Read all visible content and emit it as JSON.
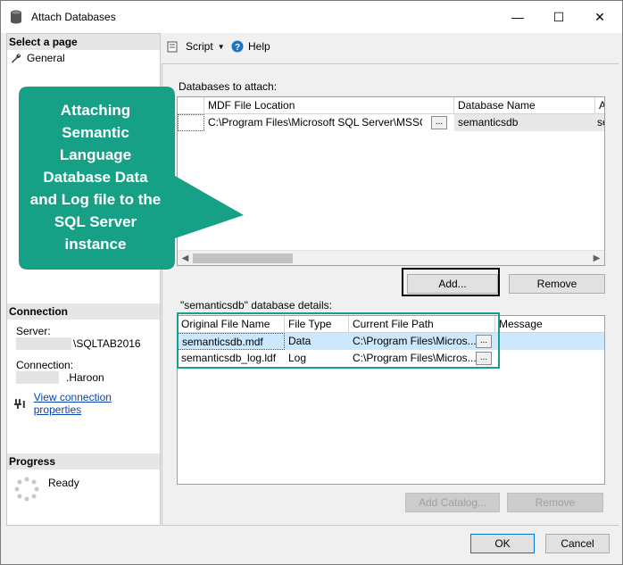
{
  "window": {
    "title": "Attach Databases",
    "minimize": "—",
    "maximize": "☐",
    "close": "✕"
  },
  "left": {
    "select_page_header": "Select a page",
    "pages": [
      {
        "label": "General",
        "icon": "wrench-icon"
      }
    ],
    "connection_header": "Connection",
    "server_label": "Server:",
    "server_value": "\\SQLTAB2016",
    "connection_label": "Connection:",
    "connection_value": ".Haroon",
    "view_connection_link": "View connection properties",
    "progress_header": "Progress",
    "progress_status": "Ready"
  },
  "toolbar": {
    "script_label": "Script",
    "help_label": "Help"
  },
  "attach": {
    "label": "Databases to attach:",
    "columns": [
      "MDF File Location",
      "Database Name",
      "At"
    ],
    "rows": [
      {
        "mdf": "C:\\Program Files\\Microsoft SQL Server\\MSSQL...",
        "browse": "...",
        "db_name": "semanticsdb",
        "attach_as": "se"
      }
    ],
    "add_button": "Add...",
    "remove_button": "Remove"
  },
  "details": {
    "label": "\"semanticsdb\" database details:",
    "columns": [
      "Original File Name",
      "File Type",
      "Current File Path",
      "Message"
    ],
    "rows": [
      {
        "name": "semanticsdb.mdf",
        "type": "Data",
        "path": "C:\\Program Files\\Micros...",
        "browse": "...",
        "message": ""
      },
      {
        "name": "semanticsdb_log.ldf",
        "type": "Log",
        "path": "C:\\Program Files\\Micros...",
        "browse": "...",
        "message": ""
      }
    ],
    "add_catalog_button": "Add Catalog...",
    "remove_button": "Remove"
  },
  "footer": {
    "ok_button": "OK",
    "cancel_button": "Cancel"
  },
  "callout": {
    "lines": [
      "Attaching",
      "Semantic",
      "Language",
      "Database Data",
      "and Log file to the",
      "SQL Server",
      "instance"
    ]
  },
  "colors": {
    "callout": "#16a085",
    "selected_row": "#cce8ff",
    "accent": "#0078d7"
  }
}
